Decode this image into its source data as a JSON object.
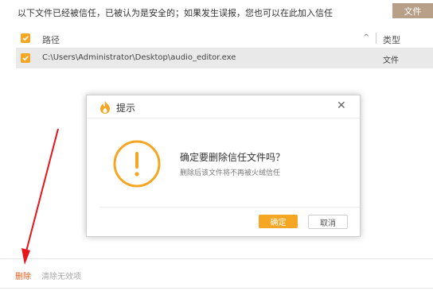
{
  "notice": "以下文件已经被信任，已被认为是安全的；如果发生误报，您也可以在此加入信任",
  "file_button": "文件",
  "table": {
    "headers": {
      "path": "路径",
      "type": "类型"
    },
    "rows": [
      {
        "path": "C:\\Users\\Administrator\\Desktop\\audio_editor.exe",
        "type": "文件",
        "checked": true
      }
    ]
  },
  "footer": {
    "delete": "删除",
    "clear": "清除无效项"
  },
  "dialog": {
    "title": "提示",
    "message": "确定要删除信任文件吗？",
    "sub_message": "删除后该文件将不再被火绒信任",
    "ok": "确定",
    "cancel": "取消"
  },
  "colors": {
    "accent": "#f5a623",
    "link_red": "#e05a1b",
    "arrow": "#e8141b"
  }
}
